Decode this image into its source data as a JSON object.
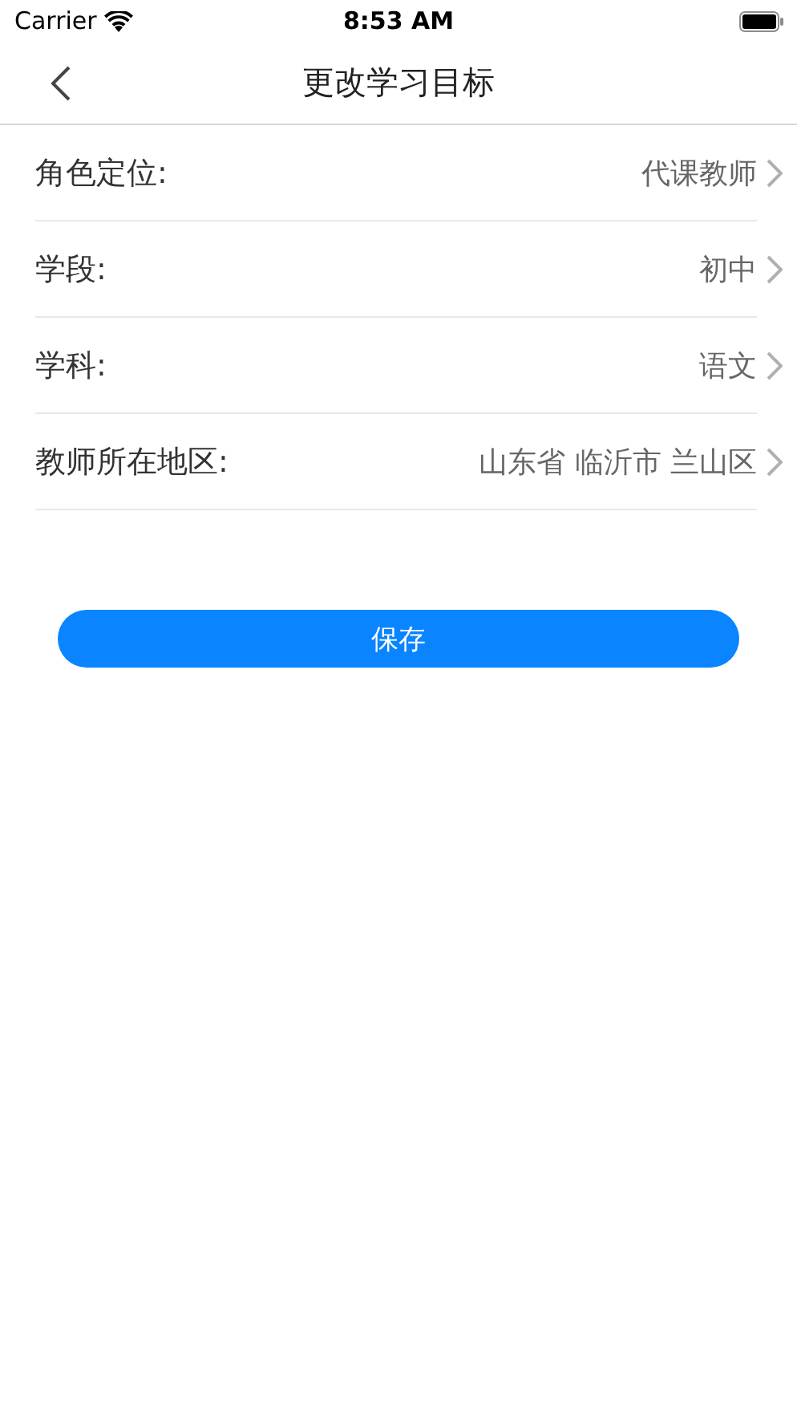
{
  "status_bar": {
    "carrier": "Carrier",
    "time": "8:53 AM"
  },
  "nav": {
    "title": "更改学习目标"
  },
  "rows": [
    {
      "label": "角色定位:",
      "value": "代课教师"
    },
    {
      "label": "学段:",
      "value": "初中"
    },
    {
      "label": "学科:",
      "value": "语文"
    },
    {
      "label": "教师所在地区:",
      "value": "山东省 临沂市 兰山区"
    }
  ],
  "save_button": {
    "label": "保存"
  }
}
